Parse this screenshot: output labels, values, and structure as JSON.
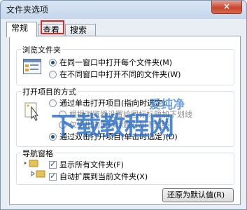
{
  "window": {
    "title": "文件夹选项",
    "close_label": "×"
  },
  "tabs": [
    {
      "label": "常规",
      "active": true
    },
    {
      "label": "查看",
      "active": false
    },
    {
      "label": "搜索",
      "active": false
    }
  ],
  "browse_group": {
    "title": "浏览文件夹",
    "options": [
      {
        "label": "在同一窗口中打开每个文件夹(M)",
        "checked": true
      },
      {
        "label": "在不同窗口中打开不同的文件夹(W)",
        "checked": false
      }
    ]
  },
  "open_group": {
    "title": "打开项目的方式",
    "options": [
      {
        "label": "通过单击打开项目(指向时选定)",
        "checked": false
      },
      {
        "label": "根据浏览器设置给图标标题加下划线",
        "checked": false,
        "disabled": true
      },
      {
        "label": "仅当指向图标标题时加下划线",
        "checked": false,
        "disabled": true
      },
      {
        "label": "通过双击打开项目(单击时选定)(D)",
        "checked": true
      }
    ]
  },
  "nav_group": {
    "title": "导航窗格",
    "options": [
      {
        "label": "显示所有文件夹(F)",
        "checked": true
      },
      {
        "label": "自动扩展到当前文件夹(X)",
        "checked": true
      }
    ]
  },
  "buttons": {
    "restore_defaults": "还原为默认值(R)"
  },
  "watermark": {
    "line1": "爱纯净",
    "line2": "下载教程网"
  },
  "colors": {
    "highlight": "#e0281e",
    "watermark": "#2c6ec8"
  }
}
